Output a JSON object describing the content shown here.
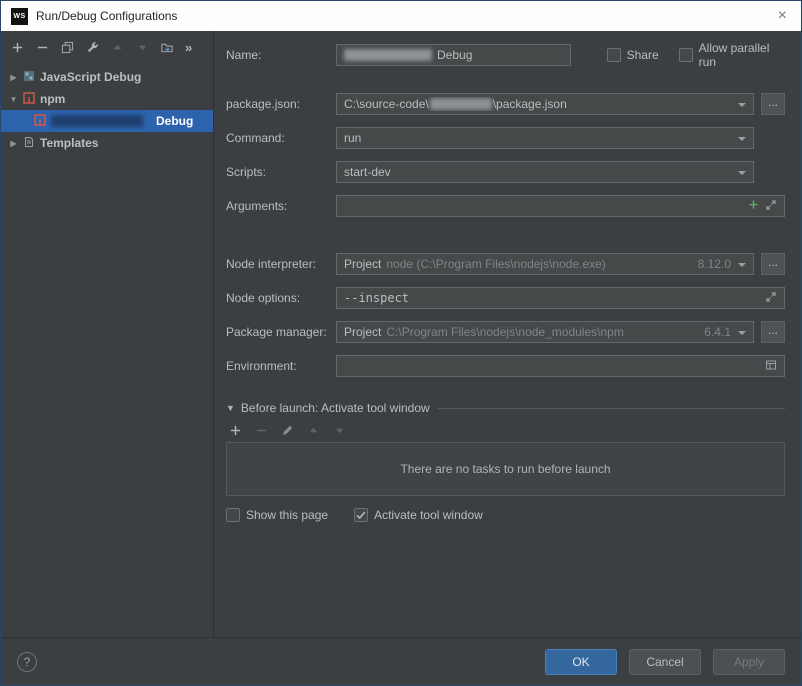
{
  "window": {
    "logo": "WS",
    "title": "Run/Debug Configurations",
    "close": "×"
  },
  "sidebar": {
    "items": [
      {
        "label": "JavaScript Debug"
      },
      {
        "label": "npm"
      },
      {
        "label": "Debug"
      },
      {
        "label": "Templates"
      }
    ]
  },
  "form": {
    "name": {
      "label": "Name:",
      "visible_value": "Debug"
    },
    "share": {
      "label": "Share",
      "checked": false
    },
    "allow_parallel": {
      "label": "Allow parallel run",
      "checked": false
    },
    "package_json": {
      "label": "package.json:",
      "path_prefix": "C:\\source-code\\",
      "path_suffix": "\\package.json"
    },
    "command": {
      "label": "Command:",
      "value": "run"
    },
    "scripts": {
      "label": "Scripts:",
      "value": "start-dev"
    },
    "arguments": {
      "label": "Arguments:",
      "value": ""
    },
    "node_interpreter": {
      "label": "Node interpreter:",
      "value": "Project",
      "detail": "node (C:\\Program Files\\nodejs\\node.exe)",
      "version": "8.12.0"
    },
    "node_options": {
      "label": "Node options:",
      "value": "--inspect"
    },
    "package_manager": {
      "label": "Package manager:",
      "value": "Project",
      "detail": "C:\\Program Files\\nodejs\\node_modules\\npm",
      "version": "6.4.1"
    },
    "environment": {
      "label": "Environment:",
      "value": ""
    },
    "browse_button": "..."
  },
  "before_launch": {
    "title": "Before launch: Activate tool window",
    "empty_text": "There are no tasks to run before launch",
    "show_this_page": {
      "label": "Show this page",
      "checked": false
    },
    "activate_tool_window": {
      "label": "Activate tool window",
      "checked": true
    }
  },
  "footer": {
    "help": "?",
    "ok": "OK",
    "cancel": "Cancel",
    "apply": "Apply"
  }
}
